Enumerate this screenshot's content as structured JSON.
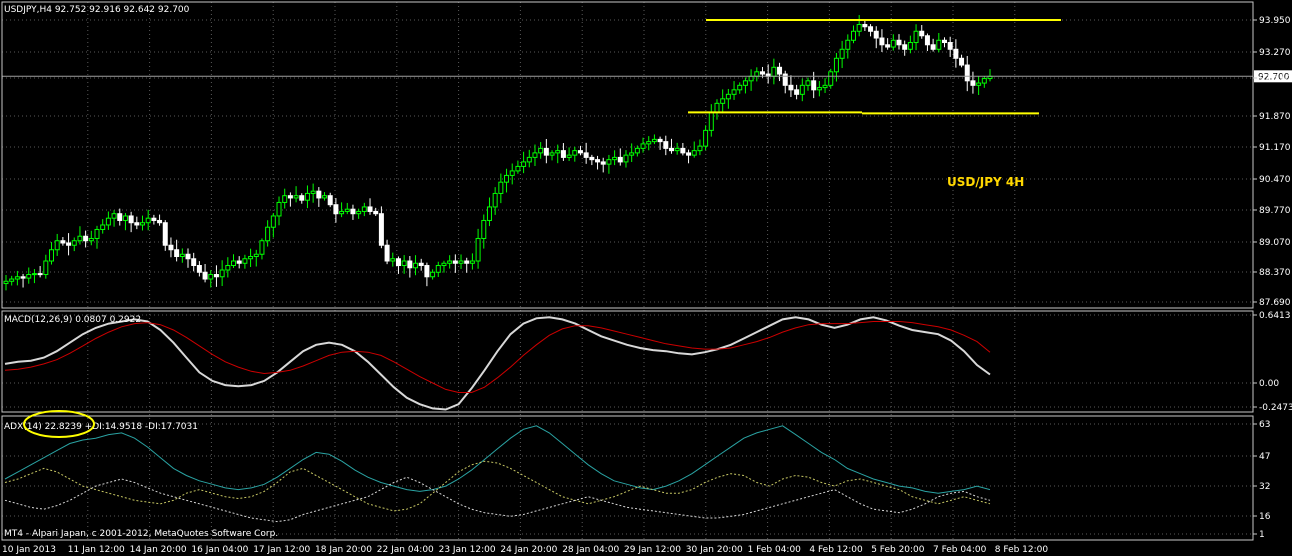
{
  "window": {
    "symbol_header": "USDJPY,H4  92.752 92.916 92.642 92.700",
    "annotation": "USD/JPY 4H",
    "copyright": "MT4 - Alpari Japan, c 2001-2012, MetaQuotes Software Corp."
  },
  "colors": {
    "background": "#000000",
    "grid": "#5a5a5a",
    "bull_candle": "#00ff00",
    "bear_candle": "#ffffff",
    "level_line": "#ffff00",
    "macd_main": "#d8d8d8",
    "macd_signal": "#cc0000",
    "adx_line": "#2aa3a3",
    "plus_di": "#c8c864",
    "minus_di": "#d8d8d8",
    "ellipse": "#ffff00"
  },
  "chart_data": [
    {
      "type": "candlestick",
      "panel": "price",
      "title": "USDJPY,H4",
      "ohlc_header": [
        92.752,
        92.916,
        92.642,
        92.7
      ],
      "current_price_label": "92.700",
      "y_ticks": [
        "93.950",
        "93.270",
        "92.570",
        "91.870",
        "91.170",
        "90.470",
        "89.770",
        "89.070",
        "88.370",
        "87.690"
      ],
      "ylim": [
        87.69,
        93.95
      ],
      "x_ticks": [
        "10 Jan 2013",
        "11 Jan 12:00",
        "14 Jan 20:00",
        "16 Jan 04:00",
        "17 Jan 12:00",
        "18 Jan 20:00",
        "22 Jan 04:00",
        "23 Jan 12:00",
        "24 Jan 20:00",
        "28 Jan 04:00",
        "29 Jan 12:00",
        "30 Jan 20:00",
        "1 Feb 04:00",
        "4 Feb 12:00",
        "5 Feb 20:00",
        "7 Feb 04:00",
        "8 Feb 12:00"
      ],
      "closes": [
        88.15,
        88.2,
        88.25,
        88.22,
        88.3,
        88.32,
        88.3,
        88.6,
        88.85,
        89.05,
        89.0,
        88.95,
        89.05,
        89.15,
        89.05,
        89.1,
        89.3,
        89.4,
        89.55,
        89.65,
        89.5,
        89.6,
        89.45,
        89.4,
        89.45,
        89.55,
        89.5,
        89.45,
        88.95,
        88.85,
        88.7,
        88.75,
        88.65,
        88.5,
        88.35,
        88.2,
        88.3,
        88.25,
        88.4,
        88.5,
        88.6,
        88.55,
        88.65,
        88.7,
        88.75,
        89.05,
        89.35,
        89.6,
        89.9,
        90.05,
        90.0,
        90.05,
        89.95,
        90.1,
        90.15,
        90.0,
        90.05,
        89.85,
        89.65,
        89.7,
        89.75,
        89.65,
        89.7,
        89.8,
        89.7,
        89.65,
        88.95,
        88.6,
        88.65,
        88.5,
        88.6,
        88.45,
        88.55,
        88.5,
        88.25,
        88.35,
        88.5,
        88.55,
        88.6,
        88.55,
        88.6,
        88.55,
        88.6,
        89.1,
        89.5,
        89.8,
        90.1,
        90.35,
        90.5,
        90.6,
        90.7,
        90.8,
        90.9,
        91.0,
        91.1,
        90.95,
        91.0,
        91.05,
        90.9,
        90.95,
        91.05,
        91.0,
        90.9,
        90.85,
        90.8,
        90.75,
        90.85,
        90.9,
        90.8,
        90.95,
        91.0,
        91.1,
        91.2,
        91.25,
        91.3,
        91.25,
        91.1,
        91.05,
        91.1,
        91.0,
        90.95,
        91.05,
        91.15,
        91.5,
        91.9,
        92.1,
        92.2,
        92.3,
        92.4,
        92.5,
        92.6,
        92.7,
        92.8,
        92.75,
        92.7,
        92.9,
        92.75,
        92.5,
        92.4,
        92.3,
        92.5,
        92.6,
        92.4,
        92.45,
        92.5,
        92.8,
        93.1,
        93.3,
        93.5,
        93.7,
        93.85,
        93.8,
        93.7,
        93.55,
        93.4,
        93.35,
        93.5,
        93.4,
        93.3,
        93.45,
        93.7,
        93.6,
        93.4,
        93.3,
        93.5,
        93.45,
        93.3,
        93.1,
        92.95,
        92.6,
        92.5,
        92.55,
        92.65,
        92.7
      ],
      "support_level": 91.9,
      "resistance_level": 93.95
    },
    {
      "type": "line",
      "panel": "MACD",
      "header": "MACD(12,26,9) 0.0807 0.2922",
      "y_ticks": [
        "0.6413",
        "0.00",
        "-0.2473"
      ],
      "ylim": [
        -0.2473,
        0.6413
      ],
      "series": [
        {
          "name": "MACD",
          "values": [
            0.18,
            0.2,
            0.21,
            0.24,
            0.3,
            0.38,
            0.46,
            0.52,
            0.56,
            0.58,
            0.6,
            0.58,
            0.5,
            0.38,
            0.24,
            0.1,
            0.02,
            -0.02,
            -0.03,
            -0.02,
            0.02,
            0.1,
            0.2,
            0.3,
            0.36,
            0.38,
            0.36,
            0.3,
            0.2,
            0.08,
            -0.04,
            -0.14,
            -0.2,
            -0.24,
            -0.25,
            -0.2,
            -0.05,
            0.12,
            0.3,
            0.46,
            0.56,
            0.61,
            0.62,
            0.6,
            0.56,
            0.5,
            0.44,
            0.4,
            0.36,
            0.33,
            0.31,
            0.3,
            0.28,
            0.27,
            0.29,
            0.32,
            0.36,
            0.42,
            0.48,
            0.54,
            0.6,
            0.62,
            0.6,
            0.55,
            0.52,
            0.55,
            0.6,
            0.62,
            0.59,
            0.54,
            0.5,
            0.48,
            0.46,
            0.4,
            0.3,
            0.17,
            0.08
          ]
        },
        {
          "name": "Signal",
          "values": [
            0.12,
            0.13,
            0.15,
            0.18,
            0.22,
            0.28,
            0.35,
            0.42,
            0.48,
            0.53,
            0.56,
            0.57,
            0.55,
            0.5,
            0.43,
            0.35,
            0.27,
            0.2,
            0.15,
            0.11,
            0.09,
            0.1,
            0.12,
            0.16,
            0.21,
            0.26,
            0.29,
            0.3,
            0.29,
            0.26,
            0.2,
            0.13,
            0.06,
            0.0,
            -0.06,
            -0.09,
            -0.09,
            -0.04,
            0.05,
            0.15,
            0.26,
            0.36,
            0.45,
            0.51,
            0.54,
            0.54,
            0.52,
            0.49,
            0.46,
            0.43,
            0.4,
            0.37,
            0.35,
            0.33,
            0.32,
            0.32,
            0.33,
            0.36,
            0.39,
            0.43,
            0.48,
            0.52,
            0.55,
            0.56,
            0.56,
            0.56,
            0.57,
            0.58,
            0.58,
            0.58,
            0.57,
            0.55,
            0.53,
            0.5,
            0.45,
            0.39,
            0.29
          ]
        }
      ]
    },
    {
      "type": "line",
      "panel": "ADX",
      "header": "ADX(14) 22.8239 +DI:14.9518 -DI:17.7031",
      "y_ticks": [
        "63",
        "47",
        "32",
        "16",
        "1"
      ],
      "ylim": [
        1,
        63
      ],
      "series": [
        {
          "name": "ADX",
          "values": [
            32,
            36,
            40,
            44,
            48,
            52,
            54,
            55,
            57,
            58,
            55,
            50,
            44,
            38,
            34,
            31,
            29,
            27,
            26,
            27,
            29,
            33,
            38,
            43,
            47,
            46,
            42,
            37,
            33,
            30,
            28,
            26,
            25,
            26,
            28,
            32,
            37,
            43,
            49,
            55,
            60,
            62,
            58,
            52,
            46,
            40,
            35,
            31,
            29,
            27,
            26,
            28,
            31,
            35,
            40,
            45,
            50,
            55,
            58,
            60,
            62,
            57,
            52,
            47,
            43,
            38,
            35,
            32,
            30,
            28,
            27,
            25,
            24,
            25,
            26,
            28,
            26
          ]
        },
        {
          "name": "+DI",
          "values": [
            30,
            32,
            35,
            38,
            36,
            32,
            28,
            26,
            24,
            22,
            20,
            19,
            18,
            20,
            24,
            26,
            24,
            22,
            21,
            22,
            25,
            30,
            36,
            38,
            34,
            30,
            26,
            22,
            18,
            16,
            14,
            15,
            18,
            24,
            30,
            36,
            40,
            42,
            41,
            38,
            34,
            30,
            26,
            22,
            20,
            18,
            20,
            22,
            25,
            28,
            26,
            24,
            24,
            26,
            30,
            33,
            35,
            34,
            30,
            28,
            32,
            34,
            33,
            30,
            28,
            31,
            32,
            30,
            28,
            26,
            22,
            20,
            18,
            20,
            22,
            20,
            18
          ]
        },
        {
          "name": "-DI",
          "values": [
            20,
            18,
            16,
            15,
            17,
            20,
            24,
            28,
            30,
            32,
            30,
            27,
            24,
            22,
            20,
            18,
            16,
            14,
            12,
            10,
            9,
            8,
            9,
            12,
            14,
            16,
            18,
            20,
            22,
            26,
            30,
            33,
            30,
            26,
            22,
            18,
            15,
            13,
            12,
            11,
            12,
            14,
            16,
            18,
            20,
            22,
            20,
            18,
            16,
            15,
            14,
            13,
            12,
            11,
            10,
            10,
            11,
            12,
            14,
            16,
            18,
            20,
            22,
            24,
            26,
            22,
            18,
            15,
            14,
            13,
            15,
            18,
            22,
            24,
            25,
            22,
            20
          ]
        }
      ]
    }
  ]
}
